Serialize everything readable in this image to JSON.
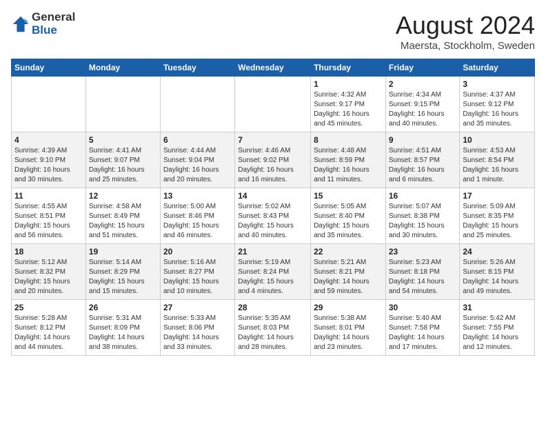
{
  "header": {
    "logo": {
      "general": "General",
      "blue": "Blue"
    },
    "title": "August 2024",
    "location": "Maersta, Stockholm, Sweden"
  },
  "calendar": {
    "weekdays": [
      "Sunday",
      "Monday",
      "Tuesday",
      "Wednesday",
      "Thursday",
      "Friday",
      "Saturday"
    ],
    "weeks": [
      [
        {
          "day": "",
          "info": ""
        },
        {
          "day": "",
          "info": ""
        },
        {
          "day": "",
          "info": ""
        },
        {
          "day": "",
          "info": ""
        },
        {
          "day": "1",
          "info": "Sunrise: 4:32 AM\nSunset: 9:17 PM\nDaylight: 16 hours\nand 45 minutes."
        },
        {
          "day": "2",
          "info": "Sunrise: 4:34 AM\nSunset: 9:15 PM\nDaylight: 16 hours\nand 40 minutes."
        },
        {
          "day": "3",
          "info": "Sunrise: 4:37 AM\nSunset: 9:12 PM\nDaylight: 16 hours\nand 35 minutes."
        }
      ],
      [
        {
          "day": "4",
          "info": "Sunrise: 4:39 AM\nSunset: 9:10 PM\nDaylight: 16 hours\nand 30 minutes."
        },
        {
          "day": "5",
          "info": "Sunrise: 4:41 AM\nSunset: 9:07 PM\nDaylight: 16 hours\nand 25 minutes."
        },
        {
          "day": "6",
          "info": "Sunrise: 4:44 AM\nSunset: 9:04 PM\nDaylight: 16 hours\nand 20 minutes."
        },
        {
          "day": "7",
          "info": "Sunrise: 4:46 AM\nSunset: 9:02 PM\nDaylight: 16 hours\nand 16 minutes."
        },
        {
          "day": "8",
          "info": "Sunrise: 4:48 AM\nSunset: 8:59 PM\nDaylight: 16 hours\nand 11 minutes."
        },
        {
          "day": "9",
          "info": "Sunrise: 4:51 AM\nSunset: 8:57 PM\nDaylight: 16 hours\nand 6 minutes."
        },
        {
          "day": "10",
          "info": "Sunrise: 4:53 AM\nSunset: 8:54 PM\nDaylight: 16 hours\nand 1 minute."
        }
      ],
      [
        {
          "day": "11",
          "info": "Sunrise: 4:55 AM\nSunset: 8:51 PM\nDaylight: 15 hours\nand 56 minutes."
        },
        {
          "day": "12",
          "info": "Sunrise: 4:58 AM\nSunset: 8:49 PM\nDaylight: 15 hours\nand 51 minutes."
        },
        {
          "day": "13",
          "info": "Sunrise: 5:00 AM\nSunset: 8:46 PM\nDaylight: 15 hours\nand 46 minutes."
        },
        {
          "day": "14",
          "info": "Sunrise: 5:02 AM\nSunset: 8:43 PM\nDaylight: 15 hours\nand 40 minutes."
        },
        {
          "day": "15",
          "info": "Sunrise: 5:05 AM\nSunset: 8:40 PM\nDaylight: 15 hours\nand 35 minutes."
        },
        {
          "day": "16",
          "info": "Sunrise: 5:07 AM\nSunset: 8:38 PM\nDaylight: 15 hours\nand 30 minutes."
        },
        {
          "day": "17",
          "info": "Sunrise: 5:09 AM\nSunset: 8:35 PM\nDaylight: 15 hours\nand 25 minutes."
        }
      ],
      [
        {
          "day": "18",
          "info": "Sunrise: 5:12 AM\nSunset: 8:32 PM\nDaylight: 15 hours\nand 20 minutes."
        },
        {
          "day": "19",
          "info": "Sunrise: 5:14 AM\nSunset: 8:29 PM\nDaylight: 15 hours\nand 15 minutes."
        },
        {
          "day": "20",
          "info": "Sunrise: 5:16 AM\nSunset: 8:27 PM\nDaylight: 15 hours\nand 10 minutes."
        },
        {
          "day": "21",
          "info": "Sunrise: 5:19 AM\nSunset: 8:24 PM\nDaylight: 15 hours\nand 4 minutes."
        },
        {
          "day": "22",
          "info": "Sunrise: 5:21 AM\nSunset: 8:21 PM\nDaylight: 14 hours\nand 59 minutes."
        },
        {
          "day": "23",
          "info": "Sunrise: 5:23 AM\nSunset: 8:18 PM\nDaylight: 14 hours\nand 54 minutes."
        },
        {
          "day": "24",
          "info": "Sunrise: 5:26 AM\nSunset: 8:15 PM\nDaylight: 14 hours\nand 49 minutes."
        }
      ],
      [
        {
          "day": "25",
          "info": "Sunrise: 5:28 AM\nSunset: 8:12 PM\nDaylight: 14 hours\nand 44 minutes."
        },
        {
          "day": "26",
          "info": "Sunrise: 5:31 AM\nSunset: 8:09 PM\nDaylight: 14 hours\nand 38 minutes."
        },
        {
          "day": "27",
          "info": "Sunrise: 5:33 AM\nSunset: 8:06 PM\nDaylight: 14 hours\nand 33 minutes."
        },
        {
          "day": "28",
          "info": "Sunrise: 5:35 AM\nSunset: 8:03 PM\nDaylight: 14 hours\nand 28 minutes."
        },
        {
          "day": "29",
          "info": "Sunrise: 5:38 AM\nSunset: 8:01 PM\nDaylight: 14 hours\nand 23 minutes."
        },
        {
          "day": "30",
          "info": "Sunrise: 5:40 AM\nSunset: 7:58 PM\nDaylight: 14 hours\nand 17 minutes."
        },
        {
          "day": "31",
          "info": "Sunrise: 5:42 AM\nSunset: 7:55 PM\nDaylight: 14 hours\nand 12 minutes."
        }
      ]
    ]
  }
}
